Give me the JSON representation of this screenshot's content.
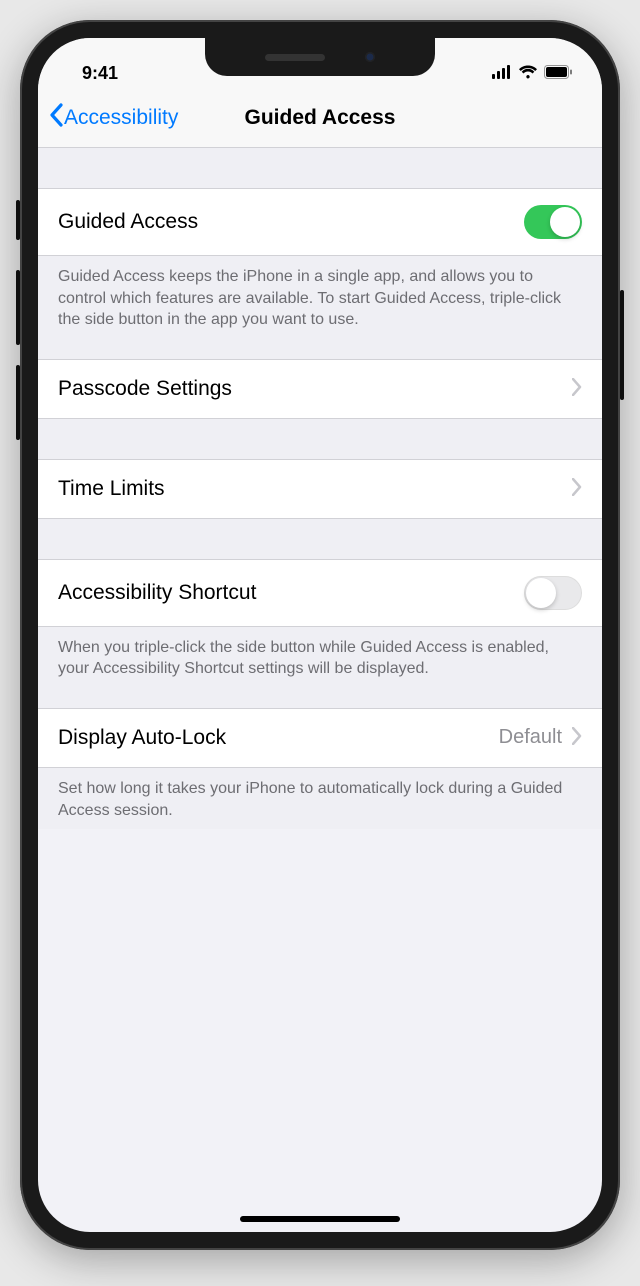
{
  "status": {
    "time": "9:41"
  },
  "nav": {
    "back": "Accessibility",
    "title": "Guided Access"
  },
  "rows": {
    "guidedAccess": {
      "label": "Guided Access",
      "on": true
    },
    "guidedAccessFooter": "Guided Access keeps the iPhone in a single app, and allows you to control which features are available. To start Guided Access, triple-click the side button in the app you want to use.",
    "passcode": {
      "label": "Passcode Settings"
    },
    "timeLimits": {
      "label": "Time Limits"
    },
    "shortcut": {
      "label": "Accessibility Shortcut",
      "on": false
    },
    "shortcutFooter": "When you triple-click the side button while Guided Access is enabled, your Accessibility Shortcut settings will be displayed.",
    "autoLock": {
      "label": "Display Auto-Lock",
      "value": "Default"
    },
    "autoLockFooter": "Set how long it takes your iPhone to automatically lock during a Guided Access session."
  }
}
